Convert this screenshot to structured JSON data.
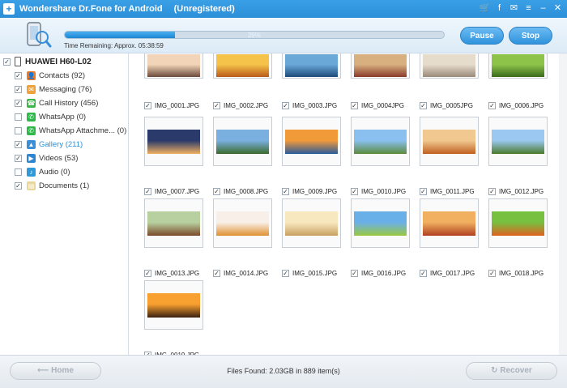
{
  "titlebar": {
    "title": "Wondershare Dr.Fone for Android",
    "status": "(Unregistered)",
    "icons": [
      "cart-icon",
      "facebook-icon",
      "message-icon",
      "menu-icon",
      "minimize-icon",
      "close-icon"
    ]
  },
  "scan": {
    "progress_percent": 29,
    "progress_label": "29%",
    "time_remaining": "Time Remaining: Approx. 05:38:59",
    "pause_label": "Pause",
    "stop_label": "Stop"
  },
  "sidebar": {
    "device": "HUAWEI H60-L02",
    "items": [
      {
        "label": "Contacts (92)",
        "icon": "contacts-icon",
        "color": "#f07a22",
        "checked": true
      },
      {
        "label": "Messaging (76)",
        "icon": "messaging-icon",
        "color": "#f0a23a",
        "checked": true
      },
      {
        "label": "Call History (456)",
        "icon": "call-history-icon",
        "color": "#3ab54a",
        "checked": true
      },
      {
        "label": "WhatsApp (0)",
        "icon": "whatsapp-icon",
        "color": "#2fb84a",
        "checked": false
      },
      {
        "label": "WhatsApp Attachme... (0)",
        "icon": "whatsapp-attachment-icon",
        "color": "#2fb84a",
        "checked": false
      },
      {
        "label": "Gallery (211)",
        "icon": "gallery-icon",
        "color": "#3a8fd8",
        "checked": true
      },
      {
        "label": "Videos (53)",
        "icon": "videos-icon",
        "color": "#2e86d0",
        "checked": true
      },
      {
        "label": "Audio (0)",
        "icon": "audio-icon",
        "color": "#2e9ad8",
        "checked": false
      },
      {
        "label": "Documents (1)",
        "icon": "documents-icon",
        "color": "#e8d79a",
        "checked": true
      }
    ]
  },
  "gallery": {
    "files": [
      "IMG_0001.JPG",
      "IMG_0002.JPG",
      "IMG_0003.JPG",
      "IMG_0004JPG",
      "IMG_0005JPG",
      "IMG_0006.JPG",
      "IMG_0007.JPG",
      "IMG_0008.JPG",
      "IMG_0009.JPG",
      "IMG_0010.JPG",
      "IMG_0011.JPG",
      "IMG_0012.JPG",
      "IMG_0013.JPG",
      "IMG_0014.JPG",
      "IMG_0015.JPG",
      "IMG_0016.JPG",
      "IMG_0017.JPG",
      "IMG_0018.JPG",
      "IMG_0019.JPG"
    ]
  },
  "footer": {
    "home_label": "Home",
    "files_found": "Files Found: 2.03GB in 889 item(s)",
    "recover_label": "Recover"
  }
}
